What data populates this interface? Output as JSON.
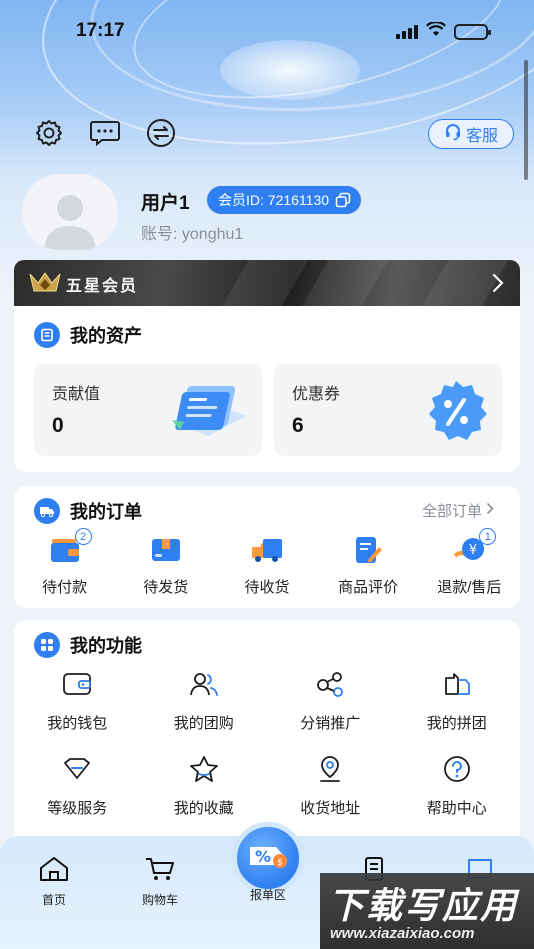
{
  "status_bar": {
    "time": "17:17"
  },
  "header": {
    "service_label": "客服"
  },
  "profile": {
    "username": "用户1",
    "member_id_label": "会员ID: 72161130",
    "account_label": "账号: yonghu1"
  },
  "vip": {
    "label": "五星会员"
  },
  "assets": {
    "title": "我的资产",
    "items": [
      {
        "label": "贡献值",
        "value": "0"
      },
      {
        "label": "优惠券",
        "value": "6"
      }
    ]
  },
  "orders": {
    "title": "我的订单",
    "all_label": "全部订单",
    "items": [
      {
        "label": "待付款",
        "badge": "2"
      },
      {
        "label": "待发货"
      },
      {
        "label": "待收货"
      },
      {
        "label": "商品评价"
      },
      {
        "label": "退款/售后",
        "badge": "1"
      }
    ]
  },
  "functions": {
    "title": "我的功能",
    "items": [
      {
        "label": "我的钱包",
        "icon": "wallet-icon"
      },
      {
        "label": "我的团购",
        "icon": "group-buy-icon"
      },
      {
        "label": "分销推广",
        "icon": "share-icon"
      },
      {
        "label": "我的拼团",
        "icon": "team-buy-icon"
      },
      {
        "label": "等级服务",
        "icon": "level-icon"
      },
      {
        "label": "我的收藏",
        "icon": "star-icon"
      },
      {
        "label": "收货地址",
        "icon": "location-icon"
      },
      {
        "label": "帮助中心",
        "icon": "help-icon"
      }
    ]
  },
  "tabbar": {
    "items": [
      {
        "label": "首页"
      },
      {
        "label": "购物车"
      },
      {
        "label": "报单区"
      }
    ]
  },
  "watermark": {
    "title": "下载写应用",
    "url": "www.xiazaixiao.com"
  },
  "colors": {
    "accent": "#2f7ff0",
    "background": "#eef3f9",
    "vip_bar": "#2b2b2b"
  }
}
